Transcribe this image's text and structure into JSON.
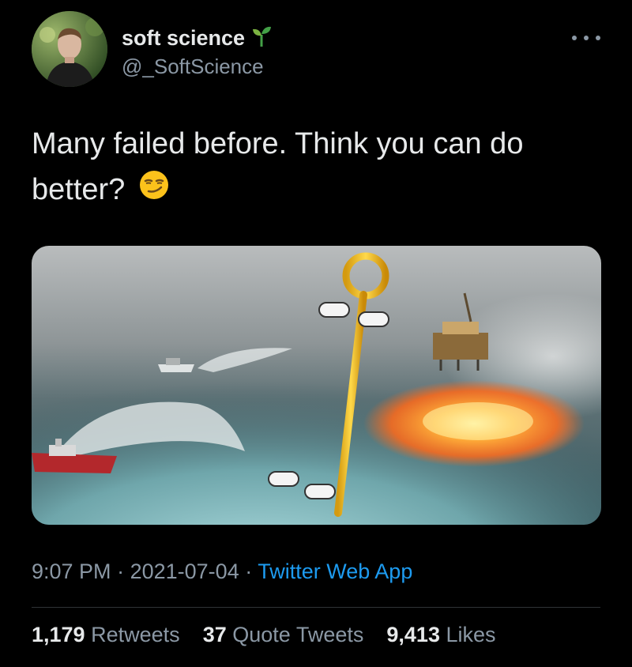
{
  "tweet": {
    "author": {
      "display_name": "soft science",
      "handle": "@_SoftScience",
      "name_emoji": "seedling-icon"
    },
    "text_line1": "Many failed before. Think you can do",
    "text_line2": "better?",
    "text_emoji": "smirking-face-icon",
    "media_alt": "Aerial photo of ocean fire near an oil platform with ships spraying water, overlaid with a golden key-like object",
    "time": "9:07 PM",
    "date": "2021-07-04",
    "separator": "·",
    "source": "Twitter Web App",
    "stats": {
      "retweets_count": "1,179",
      "retweets_label": "Retweets",
      "quotes_count": "37",
      "quotes_label": "Quote Tweets",
      "likes_count": "9,413",
      "likes_label": "Likes"
    }
  },
  "colors": {
    "background": "#000000",
    "primary_text": "#e7e9ea",
    "secondary_text": "#8b98a5",
    "link": "#1d9bf0",
    "divider": "#2f3336"
  }
}
